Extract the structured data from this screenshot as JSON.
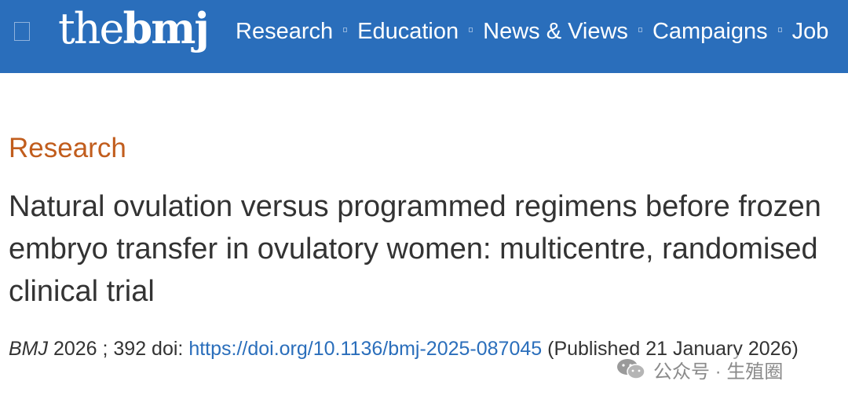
{
  "header": {
    "logo": {
      "part1": "the",
      "part2": "bmj"
    },
    "nav": [
      {
        "label": "Research"
      },
      {
        "label": "Education"
      },
      {
        "label": "News & Views"
      },
      {
        "label": "Campaigns"
      },
      {
        "label": "Job"
      }
    ],
    "colors": {
      "background": "#2a6ebb",
      "text": "#ffffff"
    }
  },
  "article": {
    "section": "Research",
    "title": "Natural ovulation versus programmed regimens before frozen embryo transfer in ovulatory women: multicentre, randomised clinical trial",
    "citation": {
      "journal": "BMJ",
      "volume": " 2026 ; 392  doi: ",
      "doi": "https://doi.org/10.1136/bmj-2025-087045",
      "published": " (Published 21 January 2026)"
    },
    "colors": {
      "section": "#c15d1d",
      "link": "#2a6ebb",
      "text": "#333333"
    }
  },
  "watermark": {
    "icon": "wechat-icon",
    "text": "公众号 · 生殖圈"
  }
}
